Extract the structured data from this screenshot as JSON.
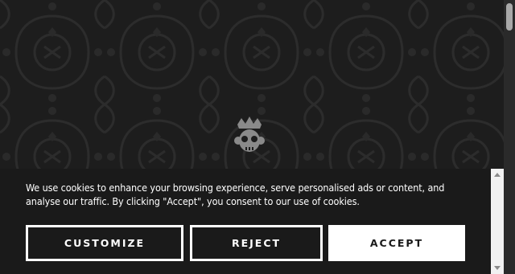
{
  "cookie_banner": {
    "text": "We use cookies to enhance your browsing experience, serve personalised ads or content, and analyse our traffic. By clicking \"Accept\", you consent to our use of cookies.",
    "customize_label": "CUSTOMIZE",
    "reject_label": "REJECT",
    "accept_label": "ACCEPT"
  },
  "background": {
    "logo_icon": "crowned-skull-monkey-icon",
    "pattern": "dark-damask-pattern"
  },
  "colors": {
    "page_bg": "#1d1d1d",
    "pattern": "#2c2c2c",
    "banner_bg": "#1a1a1a",
    "button_text_light": "#ffffff",
    "button_solid_bg": "#ffffff"
  }
}
